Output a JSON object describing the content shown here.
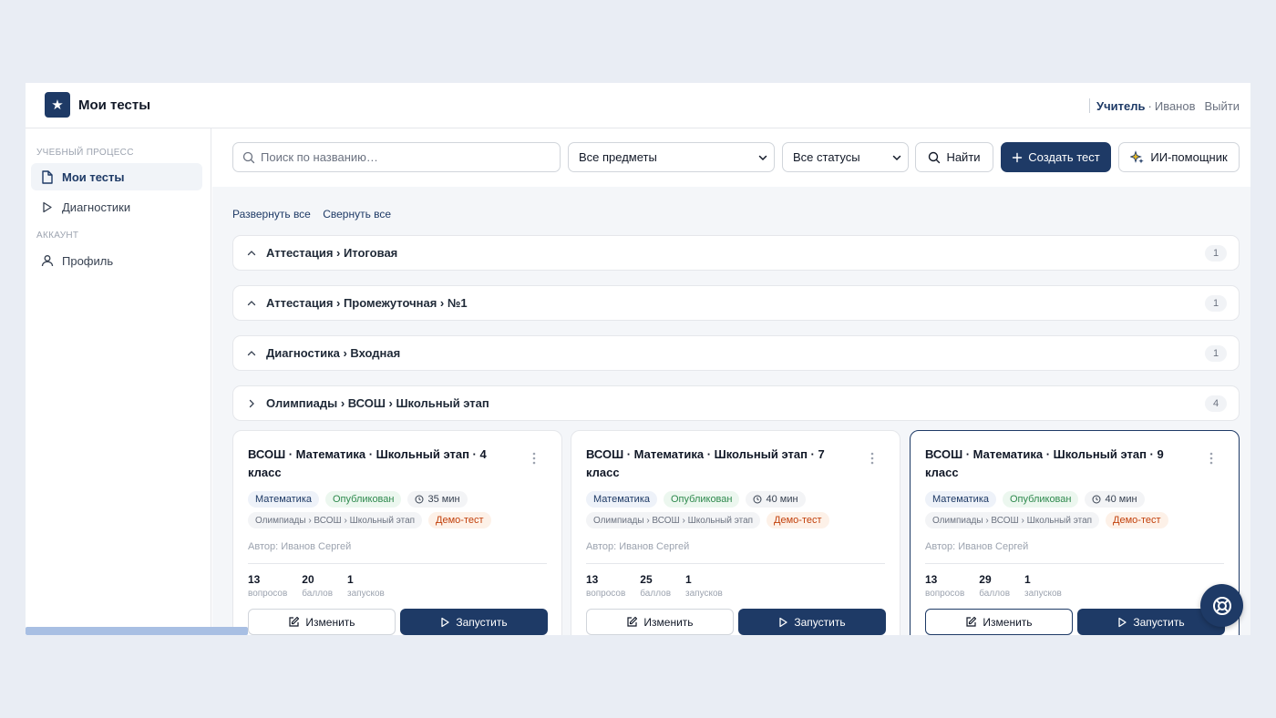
{
  "header": {
    "app_title": "Мои тесты",
    "logo_icon": "star-icon",
    "role": "Учитель",
    "separator": "·",
    "user_name": "Иванов",
    "logout": "Выйти"
  },
  "sidebar": {
    "section1": "УЧЕБНЫЙ ПРОЦЕСС",
    "section2": "АККАУНТ",
    "items": [
      {
        "label": "Мои тесты",
        "icon": "file-icon",
        "active": true
      },
      {
        "label": "Диагностики",
        "icon": "play-icon",
        "active": false
      },
      {
        "label": "Профиль",
        "icon": "user-icon",
        "active": false
      }
    ]
  },
  "toolbar": {
    "search_placeholder": "Поиск по названию…",
    "subject_select": "Все предметы",
    "status_select": "Все статусы",
    "find_label": "Найти",
    "create_label": "Создать тест",
    "ai_label": "ИИ-помощник"
  },
  "links": {
    "expand_all": "Развернуть все",
    "collapse_all": "Свернуть все"
  },
  "groups": [
    {
      "title": "Аттестация › Итоговая",
      "count": "1",
      "expanded": false
    },
    {
      "title": "Аттестация › Промежуточная › №1",
      "count": "1",
      "expanded": false
    },
    {
      "title": "Диагностика › Входная",
      "count": "1",
      "expanded": false
    },
    {
      "title": "Олимпиады › ВСОШ › Школьный этап",
      "count": "4",
      "expanded": true
    }
  ],
  "cards": [
    {
      "title": "ВСОШ · Математика · Школьный этап · 4 класс",
      "subject": "Математика",
      "status": "Опубликован",
      "duration": "35 мин",
      "category": "Олимпиады › ВСОШ › Школьный этап",
      "demo": "Демо-тест",
      "author": "Автор: Иванов Сергей",
      "questions": "13",
      "questions_label": "вопросов",
      "points": "20",
      "points_label": "баллов",
      "runs": "1",
      "runs_label": "запусков",
      "edit_label": "Изменить",
      "run_label": "Запустить"
    },
    {
      "title": "ВСОШ · Математика · Школьный этап · 7 класс",
      "subject": "Математика",
      "status": "Опубликован",
      "duration": "40 мин",
      "category": "Олимпиады › ВСОШ › Школьный этап",
      "demo": "Демо-тест",
      "author": "Автор: Иванов Сергей",
      "questions": "13",
      "questions_label": "вопросов",
      "points": "25",
      "points_label": "баллов",
      "runs": "1",
      "runs_label": "запусков",
      "edit_label": "Изменить",
      "run_label": "Запустить"
    },
    {
      "title": "ВСОШ · Математика · Школьный этап · 9 класс",
      "subject": "Математика",
      "status": "Опубликован",
      "duration": "40 мин",
      "category": "Олимпиады › ВСОШ › Школьный этап",
      "demo": "Демо-тест",
      "author": "Автор: Иванов Сергей",
      "questions": "13",
      "questions_label": "вопросов",
      "points": "29",
      "points_label": "баллов",
      "runs": "1",
      "runs_label": "запусков",
      "edit_label": "Изменить",
      "run_label": "Запустить"
    }
  ],
  "fab_icon": "lifebuoy-icon",
  "colors": {
    "brand": "#1e3a66",
    "published": "#2f8a4e",
    "demo": "#c2410c"
  }
}
